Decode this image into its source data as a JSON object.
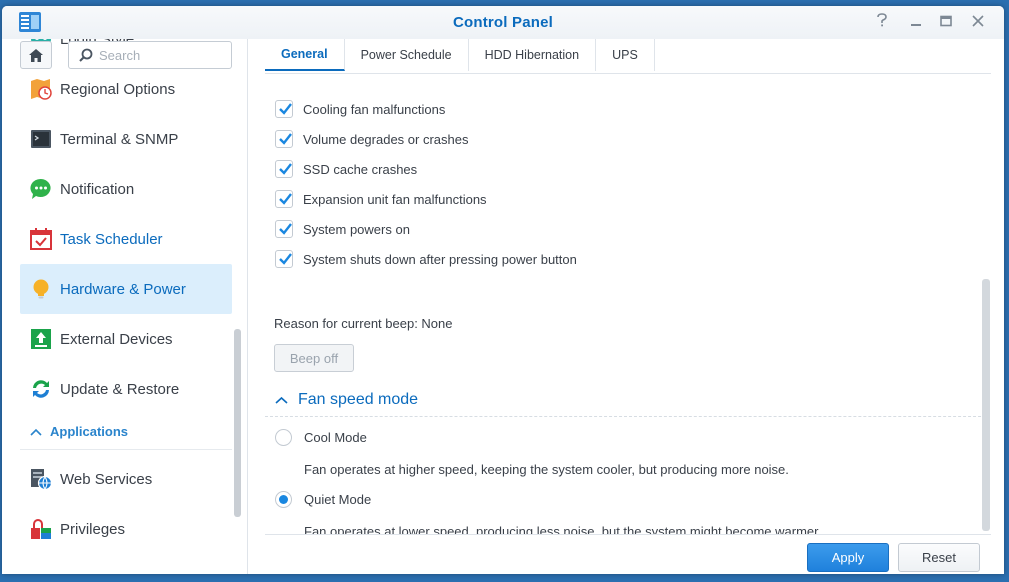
{
  "window": {
    "title": "Control Panel",
    "controls": [
      "help-icon",
      "minimize-icon",
      "maximize-icon",
      "close-icon"
    ]
  },
  "sidebar": {
    "search_placeholder": "Search",
    "items": [
      {
        "label": "Login Style",
        "icon": "login-style-icon"
      },
      {
        "label": "Regional Options",
        "icon": "regional-options-icon"
      },
      {
        "label": "Terminal & SNMP",
        "icon": "terminal-icon"
      },
      {
        "label": "Notification",
        "icon": "notification-icon"
      },
      {
        "label": "Task Scheduler",
        "icon": "task-scheduler-icon"
      },
      {
        "label": "Hardware & Power",
        "icon": "lightbulb-icon",
        "active": true
      },
      {
        "label": "External Devices",
        "icon": "external-devices-icon"
      },
      {
        "label": "Update & Restore",
        "icon": "update-restore-icon"
      }
    ],
    "section": {
      "label": "Applications"
    },
    "app_items": [
      {
        "label": "Web Services",
        "icon": "web-services-icon"
      },
      {
        "label": "Privileges",
        "icon": "privileges-icon"
      }
    ]
  },
  "tabs": [
    {
      "label": "General",
      "active": true
    },
    {
      "label": "Power Schedule"
    },
    {
      "label": "HDD Hibernation"
    },
    {
      "label": "UPS"
    }
  ],
  "beep": {
    "options": [
      {
        "label": "Cooling fan malfunctions",
        "checked": true
      },
      {
        "label": "Volume degrades or crashes",
        "checked": true
      },
      {
        "label": "SSD cache crashes",
        "checked": true
      },
      {
        "label": "Expansion unit fan malfunctions",
        "checked": true
      },
      {
        "label": "System powers on",
        "checked": true
      },
      {
        "label": "System shuts down after pressing power button",
        "checked": true
      }
    ],
    "reason": "Reason for current beep: None",
    "beep_off_label": "Beep off"
  },
  "fan": {
    "section_label": "Fan speed mode",
    "modes": [
      {
        "label": "Cool Mode",
        "selected": false,
        "description": "Fan operates at higher speed, keeping the system cooler, but producing more noise."
      },
      {
        "label": "Quiet Mode",
        "selected": true,
        "description": "Fan operates at lower speed, producing less noise, but the system might become warmer."
      }
    ]
  },
  "footer": {
    "apply_label": "Apply",
    "reset_label": "Reset"
  },
  "colors": {
    "accent": "#0b6bbd",
    "checkbox": "#1a87e0",
    "active_bg": "#dbeefc"
  }
}
